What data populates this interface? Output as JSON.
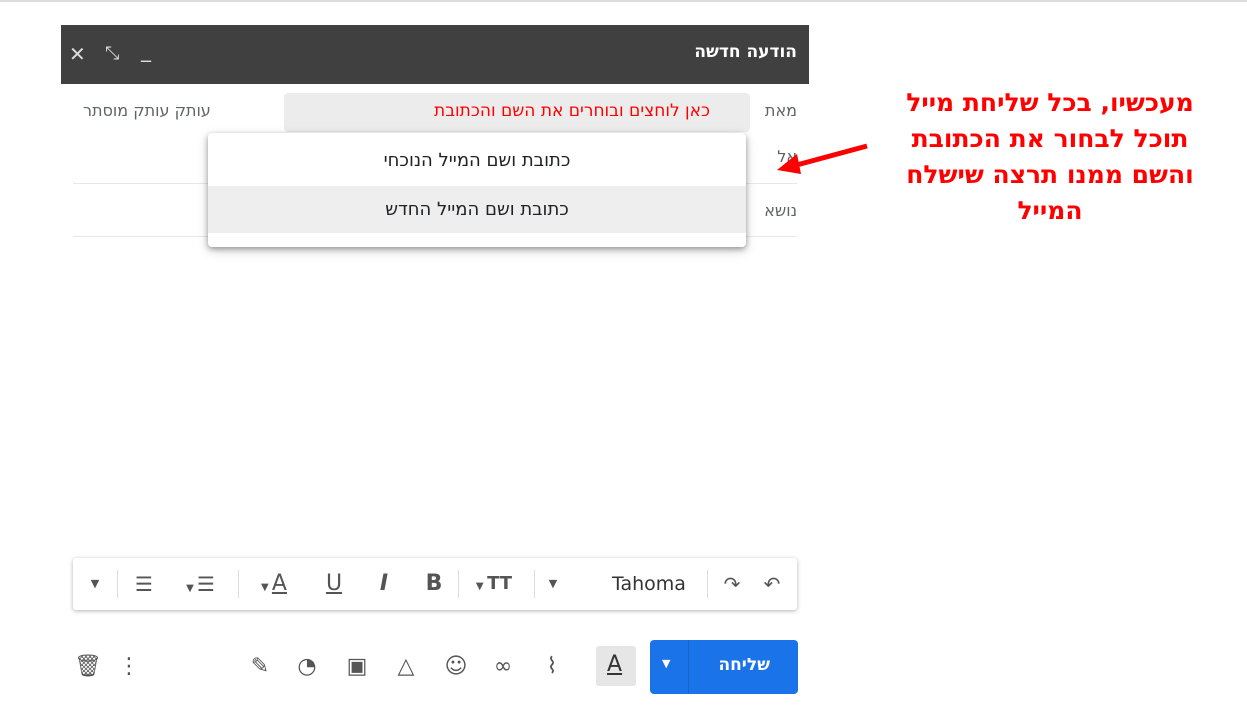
{
  "compose": {
    "title": "הודעה חדשה",
    "labels": {
      "from": "מאת",
      "to": "אל",
      "subject": "נושא"
    },
    "from_hint": "כאן לוחצים ובוחרים את השם והכתובת",
    "hidden_copy": "עותק עותק מוסתר"
  },
  "dropdown": {
    "options": [
      "כתובת ושם המייל הנוכחי",
      "כתובת ושם המייל החדש"
    ],
    "highlighted_index": 1
  },
  "toolbar": {
    "font_name": "Tahoma"
  },
  "send": {
    "label": "שליחה",
    "color": "#1a73e8"
  },
  "annotation": {
    "lines": [
      "מעכשיו, בכל שליחת מייל",
      "תוכל לבחור את הכתובת",
      "והשם ממנו תרצה שישלח",
      "המייל"
    ],
    "color": "#ff0000"
  },
  "icons": {
    "header": [
      "close-icon",
      "expand-icon",
      "minimize-icon"
    ],
    "toolbar": [
      "undo-icon",
      "redo-icon",
      "font-size-icon",
      "bold-icon",
      "italic-icon",
      "underline-icon",
      "text-color-icon",
      "align-icon",
      "numbered-list-icon",
      "more-formatting-icon"
    ],
    "bottom": [
      "delete-icon",
      "more-options-icon",
      "signature-icon",
      "confidential-icon",
      "insert-photo-icon",
      "drive-icon",
      "emoji-icon",
      "link-icon",
      "attach-icon",
      "formatting-options-icon"
    ]
  }
}
